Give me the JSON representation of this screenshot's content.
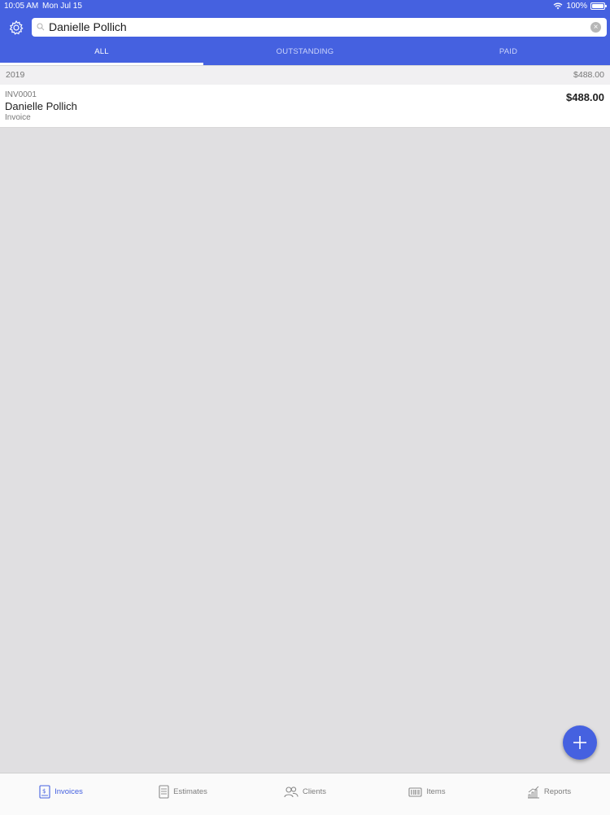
{
  "status_bar": {
    "time": "10:05 AM",
    "date": "Mon Jul 15",
    "battery": "100%"
  },
  "search": {
    "value": "Danielle Pollich",
    "clear_label": "×"
  },
  "tabs": [
    {
      "label": "ALL",
      "active": true
    },
    {
      "label": "OUTSTANDING",
      "active": false
    },
    {
      "label": "PAID",
      "active": false
    }
  ],
  "section": {
    "year": "2019",
    "total": "$488.00"
  },
  "invoices": [
    {
      "number": "INV0001",
      "client": "Danielle Pollich",
      "type": "Invoice",
      "amount": "$488.00"
    }
  ],
  "bottom_nav": [
    {
      "label": "Invoices",
      "icon": "invoice-icon",
      "active": true
    },
    {
      "label": "Estimates",
      "icon": "estimate-icon",
      "active": false
    },
    {
      "label": "Clients",
      "icon": "clients-icon",
      "active": false
    },
    {
      "label": "Items",
      "icon": "items-icon",
      "active": false
    },
    {
      "label": "Reports",
      "icon": "reports-icon",
      "active": false
    }
  ],
  "colors": {
    "accent": "#4561e0",
    "background": "#e0dfe1"
  }
}
